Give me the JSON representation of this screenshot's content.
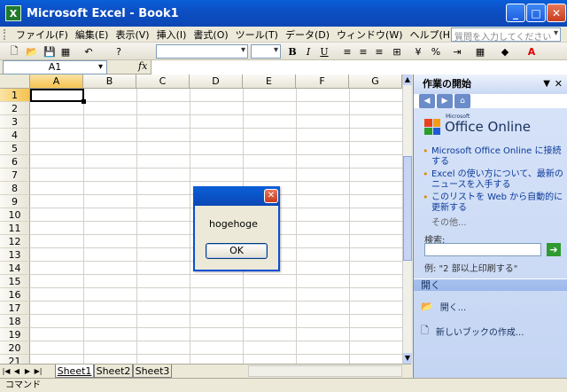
{
  "window": {
    "title": "Microsoft Excel - Book1",
    "app_icon": "X"
  },
  "menu": {
    "items": [
      "ファイル(F)",
      "編集(E)",
      "表示(V)",
      "挿入(I)",
      "書式(O)",
      "ツール(T)",
      "データ(D)",
      "ウィンドウ(W)",
      "ヘルプ(H)"
    ],
    "help_placeholder": "質問を入力してください"
  },
  "toolbar": {
    "percent": "%"
  },
  "formula": {
    "cell": "A1",
    "fx": "fx"
  },
  "grid": {
    "columns": [
      "A",
      "B",
      "C",
      "D",
      "E",
      "F",
      "G"
    ],
    "rows": [
      "1",
      "2",
      "3",
      "4",
      "5",
      "6",
      "7",
      "8",
      "9",
      "10",
      "11",
      "12",
      "13",
      "14",
      "15",
      "16",
      "17",
      "18",
      "19",
      "20",
      "21"
    ],
    "active_cell": "A1"
  },
  "sheets": [
    "Sheet1",
    "Sheet2",
    "Sheet3"
  ],
  "status": "コマンド",
  "taskpane": {
    "title": "作業の開始",
    "logo_small": "Microsoft",
    "logo_text": "Office Online",
    "links": [
      "Microsoft Office Online に接続する",
      "Excel の使い方について、最新のニュースを入手する",
      "このリストを Web から自動的に更新する"
    ],
    "more": "その他...",
    "search_label": "検索:",
    "example": "例: \"2 部以上印刷する\"",
    "open_section": "開く",
    "open_link": "開く...",
    "new_book": "新しいブックの作成..."
  },
  "dialog": {
    "message": "hogehoge",
    "ok_label": "OK"
  },
  "colors": {
    "title_blue": "#0b47b5",
    "select_orange": "#f5c34f",
    "pane_blue": "#c4d5f3"
  }
}
